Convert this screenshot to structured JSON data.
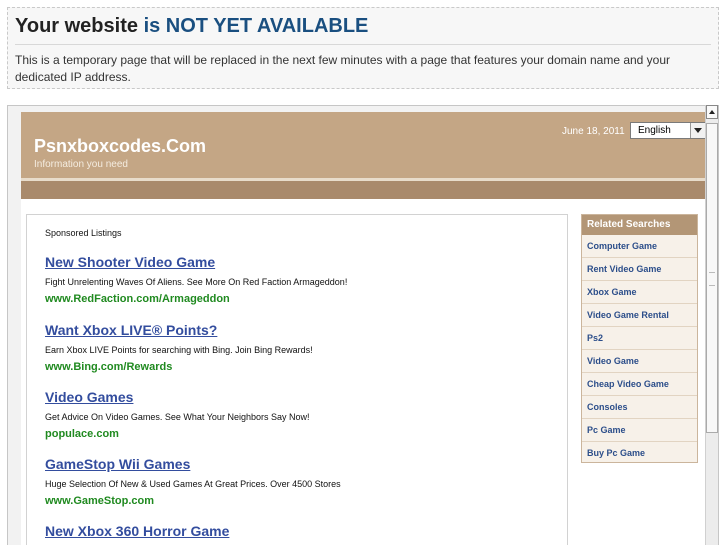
{
  "notice": {
    "title_prefix": "Your website",
    "title_highlight": "is NOT YET AVAILABLE",
    "text": "This is a temporary page that will be replaced in the next few minutes with a page that features your domain name and your dedicated IP address."
  },
  "header": {
    "site_title": "Psnxboxcodes.Com",
    "tagline": "Information you need",
    "date": "June 18, 2011",
    "language": "English"
  },
  "main": {
    "sponsored_label": "Sponsored Listings",
    "listings": [
      {
        "title": "New Shooter Video Game",
        "desc": "Fight Unrelenting Waves Of Aliens. See More On Red Faction Armageddon!",
        "url": "www.RedFaction.com/Armageddon"
      },
      {
        "title": "Want Xbox LIVE® Points?",
        "desc": "Earn Xbox LIVE Points for searching with Bing. Join Bing Rewards!",
        "url": "www.Bing.com/Rewards"
      },
      {
        "title": "Video Games",
        "desc": "Get Advice On Video Games. See What Your Neighbors Say Now!",
        "url": "populace.com"
      },
      {
        "title": "GameStop Wii Games",
        "desc": "Huge Selection Of New & Used Games At Great Prices. Over 4500 Stores",
        "url": "www.GameStop.com"
      },
      {
        "title": "New Xbox 360 Horror Game",
        "desc": "",
        "url": ""
      }
    ]
  },
  "sidebar": {
    "heading": "Related Searches",
    "items": [
      "Computer Game",
      "Rent Video Game",
      "Xbox Game",
      "Video Game Rental",
      "Ps2",
      "Video Game",
      "Cheap Video Game",
      "Consoles",
      "Pc Game",
      "Buy Pc Game"
    ]
  }
}
